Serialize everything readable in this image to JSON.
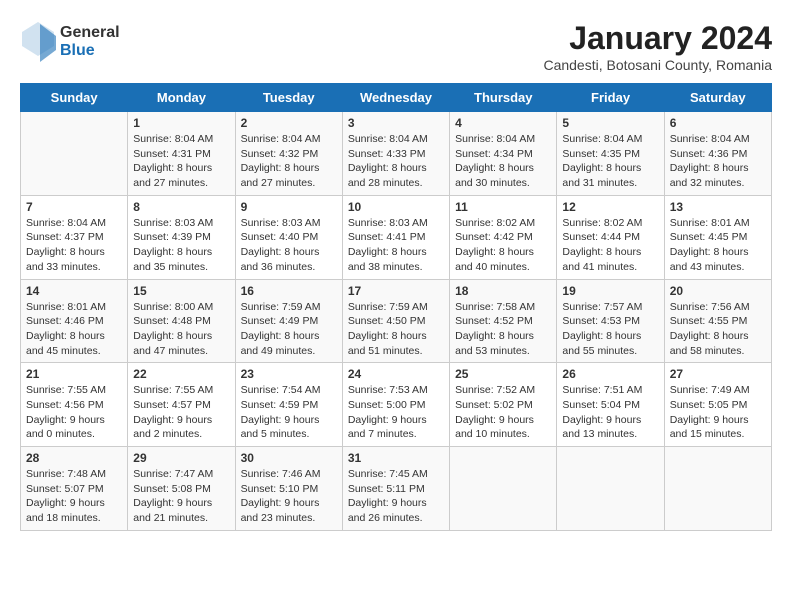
{
  "header": {
    "logo_general": "General",
    "logo_blue": "Blue",
    "month_title": "January 2024",
    "location": "Candesti, Botosani County, Romania"
  },
  "days_of_week": [
    "Sunday",
    "Monday",
    "Tuesday",
    "Wednesday",
    "Thursday",
    "Friday",
    "Saturday"
  ],
  "weeks": [
    [
      {
        "day": "",
        "content": ""
      },
      {
        "day": "1",
        "content": "Sunrise: 8:04 AM\nSunset: 4:31 PM\nDaylight: 8 hours\nand 27 minutes."
      },
      {
        "day": "2",
        "content": "Sunrise: 8:04 AM\nSunset: 4:32 PM\nDaylight: 8 hours\nand 27 minutes."
      },
      {
        "day": "3",
        "content": "Sunrise: 8:04 AM\nSunset: 4:33 PM\nDaylight: 8 hours\nand 28 minutes."
      },
      {
        "day": "4",
        "content": "Sunrise: 8:04 AM\nSunset: 4:34 PM\nDaylight: 8 hours\nand 30 minutes."
      },
      {
        "day": "5",
        "content": "Sunrise: 8:04 AM\nSunset: 4:35 PM\nDaylight: 8 hours\nand 31 minutes."
      },
      {
        "day": "6",
        "content": "Sunrise: 8:04 AM\nSunset: 4:36 PM\nDaylight: 8 hours\nand 32 minutes."
      }
    ],
    [
      {
        "day": "7",
        "content": "Sunrise: 8:04 AM\nSunset: 4:37 PM\nDaylight: 8 hours\nand 33 minutes."
      },
      {
        "day": "8",
        "content": "Sunrise: 8:03 AM\nSunset: 4:39 PM\nDaylight: 8 hours\nand 35 minutes."
      },
      {
        "day": "9",
        "content": "Sunrise: 8:03 AM\nSunset: 4:40 PM\nDaylight: 8 hours\nand 36 minutes."
      },
      {
        "day": "10",
        "content": "Sunrise: 8:03 AM\nSunset: 4:41 PM\nDaylight: 8 hours\nand 38 minutes."
      },
      {
        "day": "11",
        "content": "Sunrise: 8:02 AM\nSunset: 4:42 PM\nDaylight: 8 hours\nand 40 minutes."
      },
      {
        "day": "12",
        "content": "Sunrise: 8:02 AM\nSunset: 4:44 PM\nDaylight: 8 hours\nand 41 minutes."
      },
      {
        "day": "13",
        "content": "Sunrise: 8:01 AM\nSunset: 4:45 PM\nDaylight: 8 hours\nand 43 minutes."
      }
    ],
    [
      {
        "day": "14",
        "content": "Sunrise: 8:01 AM\nSunset: 4:46 PM\nDaylight: 8 hours\nand 45 minutes."
      },
      {
        "day": "15",
        "content": "Sunrise: 8:00 AM\nSunset: 4:48 PM\nDaylight: 8 hours\nand 47 minutes."
      },
      {
        "day": "16",
        "content": "Sunrise: 7:59 AM\nSunset: 4:49 PM\nDaylight: 8 hours\nand 49 minutes."
      },
      {
        "day": "17",
        "content": "Sunrise: 7:59 AM\nSunset: 4:50 PM\nDaylight: 8 hours\nand 51 minutes."
      },
      {
        "day": "18",
        "content": "Sunrise: 7:58 AM\nSunset: 4:52 PM\nDaylight: 8 hours\nand 53 minutes."
      },
      {
        "day": "19",
        "content": "Sunrise: 7:57 AM\nSunset: 4:53 PM\nDaylight: 8 hours\nand 55 minutes."
      },
      {
        "day": "20",
        "content": "Sunrise: 7:56 AM\nSunset: 4:55 PM\nDaylight: 8 hours\nand 58 minutes."
      }
    ],
    [
      {
        "day": "21",
        "content": "Sunrise: 7:55 AM\nSunset: 4:56 PM\nDaylight: 9 hours\nand 0 minutes."
      },
      {
        "day": "22",
        "content": "Sunrise: 7:55 AM\nSunset: 4:57 PM\nDaylight: 9 hours\nand 2 minutes."
      },
      {
        "day": "23",
        "content": "Sunrise: 7:54 AM\nSunset: 4:59 PM\nDaylight: 9 hours\nand 5 minutes."
      },
      {
        "day": "24",
        "content": "Sunrise: 7:53 AM\nSunset: 5:00 PM\nDaylight: 9 hours\nand 7 minutes."
      },
      {
        "day": "25",
        "content": "Sunrise: 7:52 AM\nSunset: 5:02 PM\nDaylight: 9 hours\nand 10 minutes."
      },
      {
        "day": "26",
        "content": "Sunrise: 7:51 AM\nSunset: 5:04 PM\nDaylight: 9 hours\nand 13 minutes."
      },
      {
        "day": "27",
        "content": "Sunrise: 7:49 AM\nSunset: 5:05 PM\nDaylight: 9 hours\nand 15 minutes."
      }
    ],
    [
      {
        "day": "28",
        "content": "Sunrise: 7:48 AM\nSunset: 5:07 PM\nDaylight: 9 hours\nand 18 minutes."
      },
      {
        "day": "29",
        "content": "Sunrise: 7:47 AM\nSunset: 5:08 PM\nDaylight: 9 hours\nand 21 minutes."
      },
      {
        "day": "30",
        "content": "Sunrise: 7:46 AM\nSunset: 5:10 PM\nDaylight: 9 hours\nand 23 minutes."
      },
      {
        "day": "31",
        "content": "Sunrise: 7:45 AM\nSunset: 5:11 PM\nDaylight: 9 hours\nand 26 minutes."
      },
      {
        "day": "",
        "content": ""
      },
      {
        "day": "",
        "content": ""
      },
      {
        "day": "",
        "content": ""
      }
    ]
  ]
}
